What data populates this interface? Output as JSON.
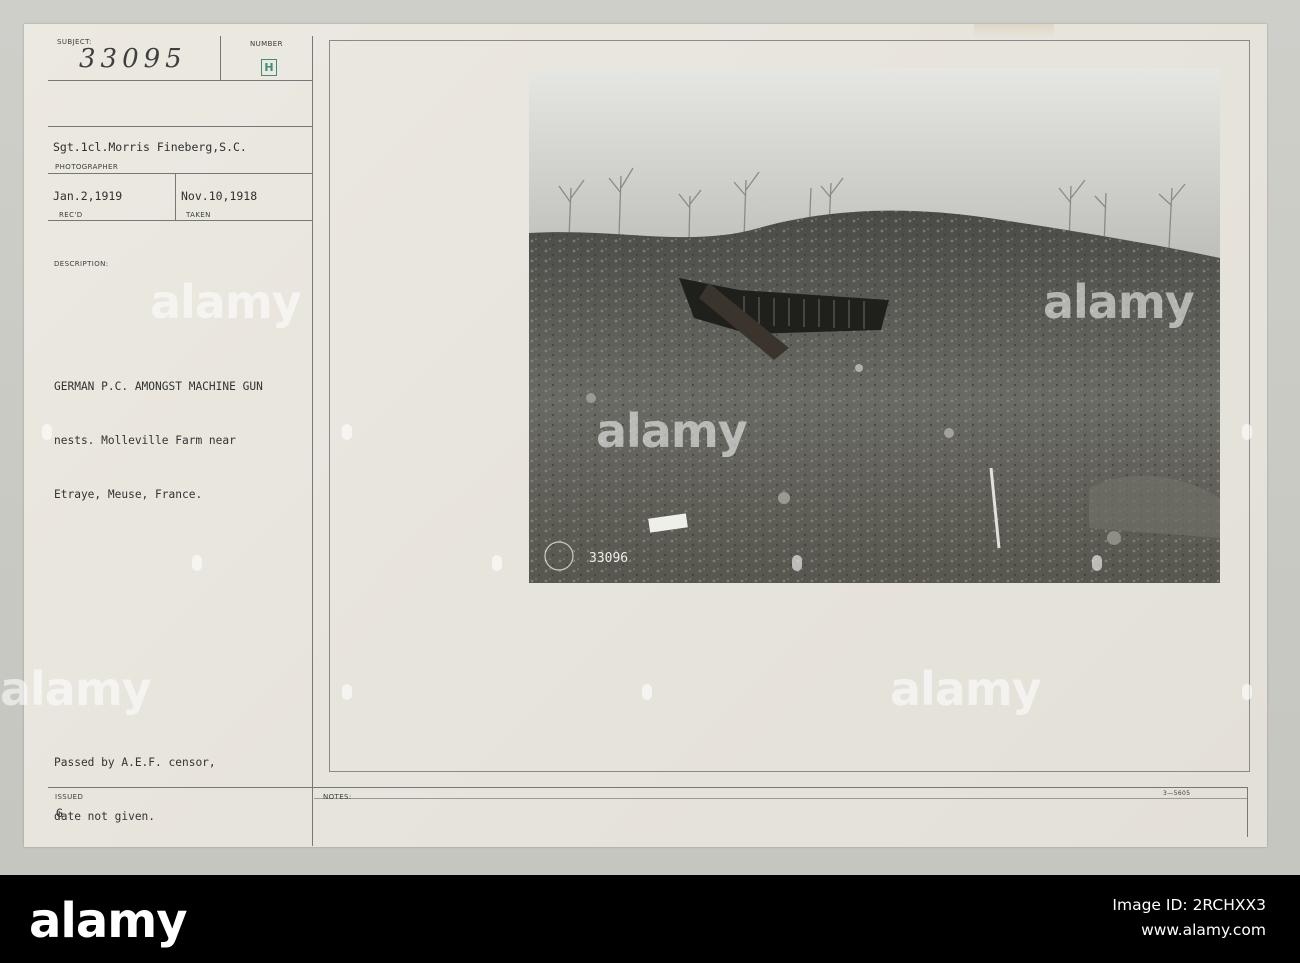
{
  "card": {
    "subject_label": "SUBJECT:",
    "subject_value": "33095",
    "number_label": "NUMBER",
    "number_value": "H",
    "photographer_name": "Sgt.1cl.Morris Fineberg,S.C.",
    "photographer_label": "PHOTOGRAPHER",
    "received_date": "Jan.2,1919",
    "received_label": "REC'D",
    "taken_date": "Nov.10,1918",
    "taken_label": "TAKEN",
    "description_label": "DESCRIPTION:",
    "description_lines": [
      "GERMAN P.C. AMONGST MACHINE GUN",
      "nests. Molleville Farm near",
      "Etraye, Meuse, France."
    ],
    "censor_lines": [
      "Passed by A.E.F. censor,",
      "date not given."
    ],
    "issued_label": "ISSUED",
    "issued_value": "G",
    "notes_label": "NOTES:",
    "form_number": "3—5605",
    "photo_negative_number": "33096"
  },
  "watermark": {
    "text": "alamy"
  },
  "footer": {
    "logo": "alamy",
    "image_id_label": "Image ID:",
    "image_id": "2RCHXX3",
    "site": "www.alamy.com"
  },
  "colors": {
    "card_paper": "#e7e4dc",
    "stamp_green": "#3e8e78",
    "footer_bg": "#000000"
  }
}
